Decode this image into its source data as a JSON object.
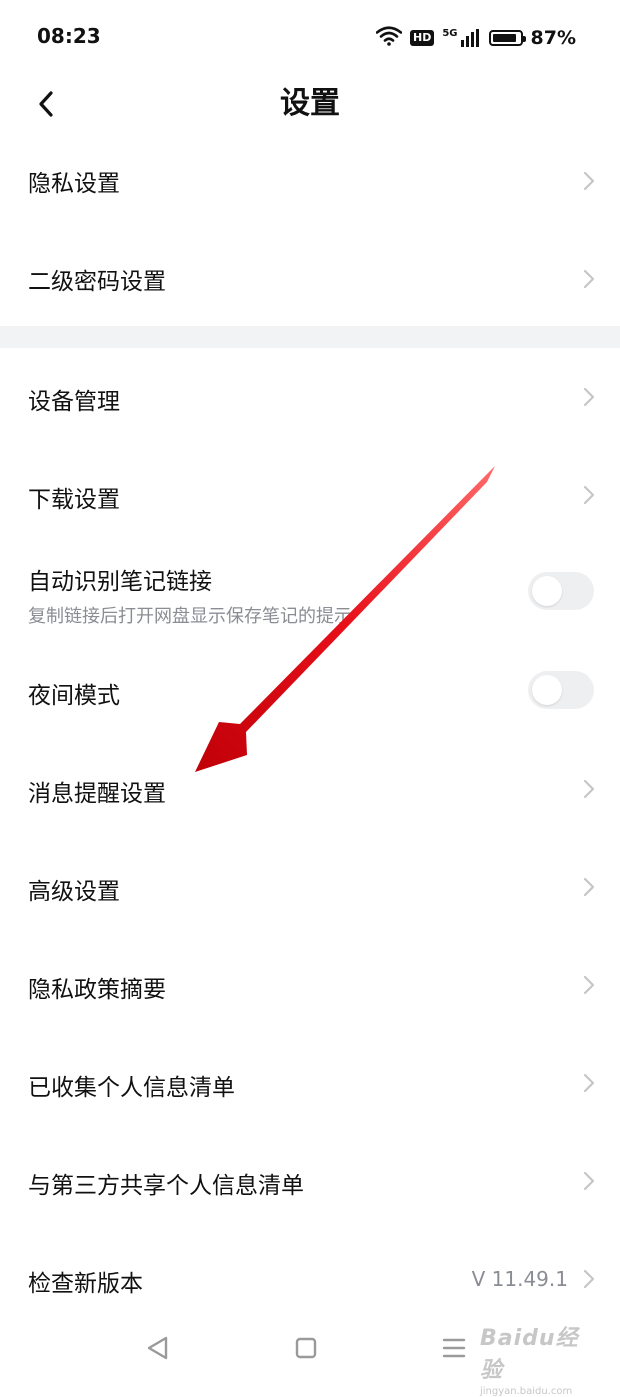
{
  "status_bar": {
    "time": "08:23",
    "network_tag": "5G",
    "hd_label": "HD",
    "battery_text": "87%",
    "battery_level": 0.87
  },
  "header": {
    "title": "设置"
  },
  "settings": {
    "privacy": {
      "label": "隐私设置"
    },
    "secondary_password": {
      "label": "二级密码设置"
    },
    "device_management": {
      "label": "设备管理"
    },
    "download": {
      "label": "下载设置"
    },
    "auto_note_link": {
      "label": "自动识别笔记链接",
      "description": "复制链接后打开网盘显示保存笔记的提示",
      "enabled": false
    },
    "night_mode": {
      "label": "夜间模式",
      "enabled": false
    },
    "notification": {
      "label": "消息提醒设置"
    },
    "advanced": {
      "label": "高级设置"
    },
    "privacy_policy_summary": {
      "label": "隐私政策摘要"
    },
    "collected_info_list": {
      "label": "已收集个人信息清单"
    },
    "third_party_shared_list": {
      "label": "与第三方共享个人信息清单"
    },
    "check_update": {
      "label": "检查新版本",
      "version": "V 11.49.1"
    }
  },
  "watermark": {
    "brand": "Baidu经验",
    "url": "jingyan.baidu.com"
  },
  "colors": {
    "text_primary": "#111111",
    "text_secondary": "#8a8d93",
    "divider": "#f2f3f5",
    "toggle_off": "#eeeff1",
    "annotation_arrow": "#e8101a"
  }
}
